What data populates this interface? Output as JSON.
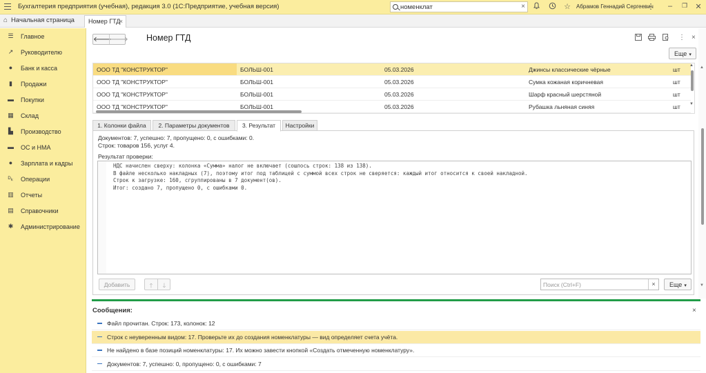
{
  "titlebar": {
    "app_title": "Бухгалтерия предприятия (учебная), редакция 3.0  (1С:Предприятие, учебная версия)",
    "search_value": "номенклат",
    "user": "Абрамов Геннадий Сергеевич"
  },
  "tabs": {
    "home_label": "Начальная страница",
    "doc_tab_label": "Номер ГТД"
  },
  "sidebar": {
    "items": [
      {
        "label": "Главное",
        "icon": "menu-lines-icon"
      },
      {
        "label": "Руководителю",
        "icon": "trend-icon"
      },
      {
        "label": "Банк и касса",
        "icon": "coin-icon"
      },
      {
        "label": "Продажи",
        "icon": "bag-icon"
      },
      {
        "label": "Покупки",
        "icon": "basket-icon"
      },
      {
        "label": "Склад",
        "icon": "warehouse-icon"
      },
      {
        "label": "Производство",
        "icon": "factory-icon"
      },
      {
        "label": "ОС и НМА",
        "icon": "truck-icon"
      },
      {
        "label": "Зарплата и кадры",
        "icon": "person-icon"
      },
      {
        "label": "Операции",
        "icon": "dt-kt-icon"
      },
      {
        "label": "Отчеты",
        "icon": "bar-chart-icon"
      },
      {
        "label": "Справочники",
        "icon": "book-icon"
      },
      {
        "label": "Администрирование",
        "icon": "gear-icon"
      }
    ]
  },
  "form": {
    "title": "Номер ГТД",
    "more_label": "Еще",
    "grid_rows": [
      {
        "org": "ООО ТД \"КОНСТРУКТОР\"",
        "doc": "БОЛЬШ-001",
        "date": "05.03.2026",
        "item": "Джинсы классические чёрные",
        "unit": "шт"
      },
      {
        "org": "ООО ТД \"КОНСТРУКТОР\"",
        "doc": "БОЛЬШ-001",
        "date": "05.03.2026",
        "item": "Сумка кожаная коричневая",
        "unit": "шт"
      },
      {
        "org": "ООО ТД \"КОНСТРУКТОР\"",
        "doc": "БОЛЬШ-001",
        "date": "05.03.2026",
        "item": "Шарф красный шерстяной",
        "unit": "шт"
      },
      {
        "org": "ООО ТД \"КОНСТРУКТОР\"",
        "doc": "БОЛЬШ-001",
        "date": "05.03.2026",
        "item": "Рубашка льняная синяя",
        "unit": "шт"
      }
    ],
    "page_tabs": [
      "1. Колонки файла",
      "2. Параметры документов",
      "3. Результат",
      "Настройки"
    ],
    "summary_line1": "Документов: 7, успешно: 7, пропущено: 0, с ошибками: 0.",
    "summary_line2": "Строк: товаров 156, услуг 4.",
    "result_label": "Результат проверки:",
    "result_lines": [
      "НДС начислен сверху: колонка «Сумма» налог не включает (сошлось строк: 138 из 138).",
      "В файле несколько накладных (7), поэтому итог под таблицей с суммой всех строк не сверяется: каждый итог относится к своей накладной.",
      "Строк к загрузке: 160, сгруппированы в 7 документ(ов).",
      "Итог: создано 7, пропущено 0, с ошибками 0."
    ],
    "add_label": "Добавить",
    "find_placeholder": "Поиск (Ctrl+F)",
    "more_label2": "Еще"
  },
  "messages": {
    "title": "Сообщения:",
    "items": [
      "Файл прочитан. Строк: 173, колонок: 12",
      "Строк с неуверенным видом: 17. Проверьте их до создания номенклатуры — вид определяет счета учёта.",
      "Не найдено в базе позиций номенклатуры: 17. Их можно завести кнопкой «Создать отмеченную номенклатуру».",
      "Документов: 7, успешно: 0, пропущено: 0, с ошибками: 7"
    ]
  }
}
